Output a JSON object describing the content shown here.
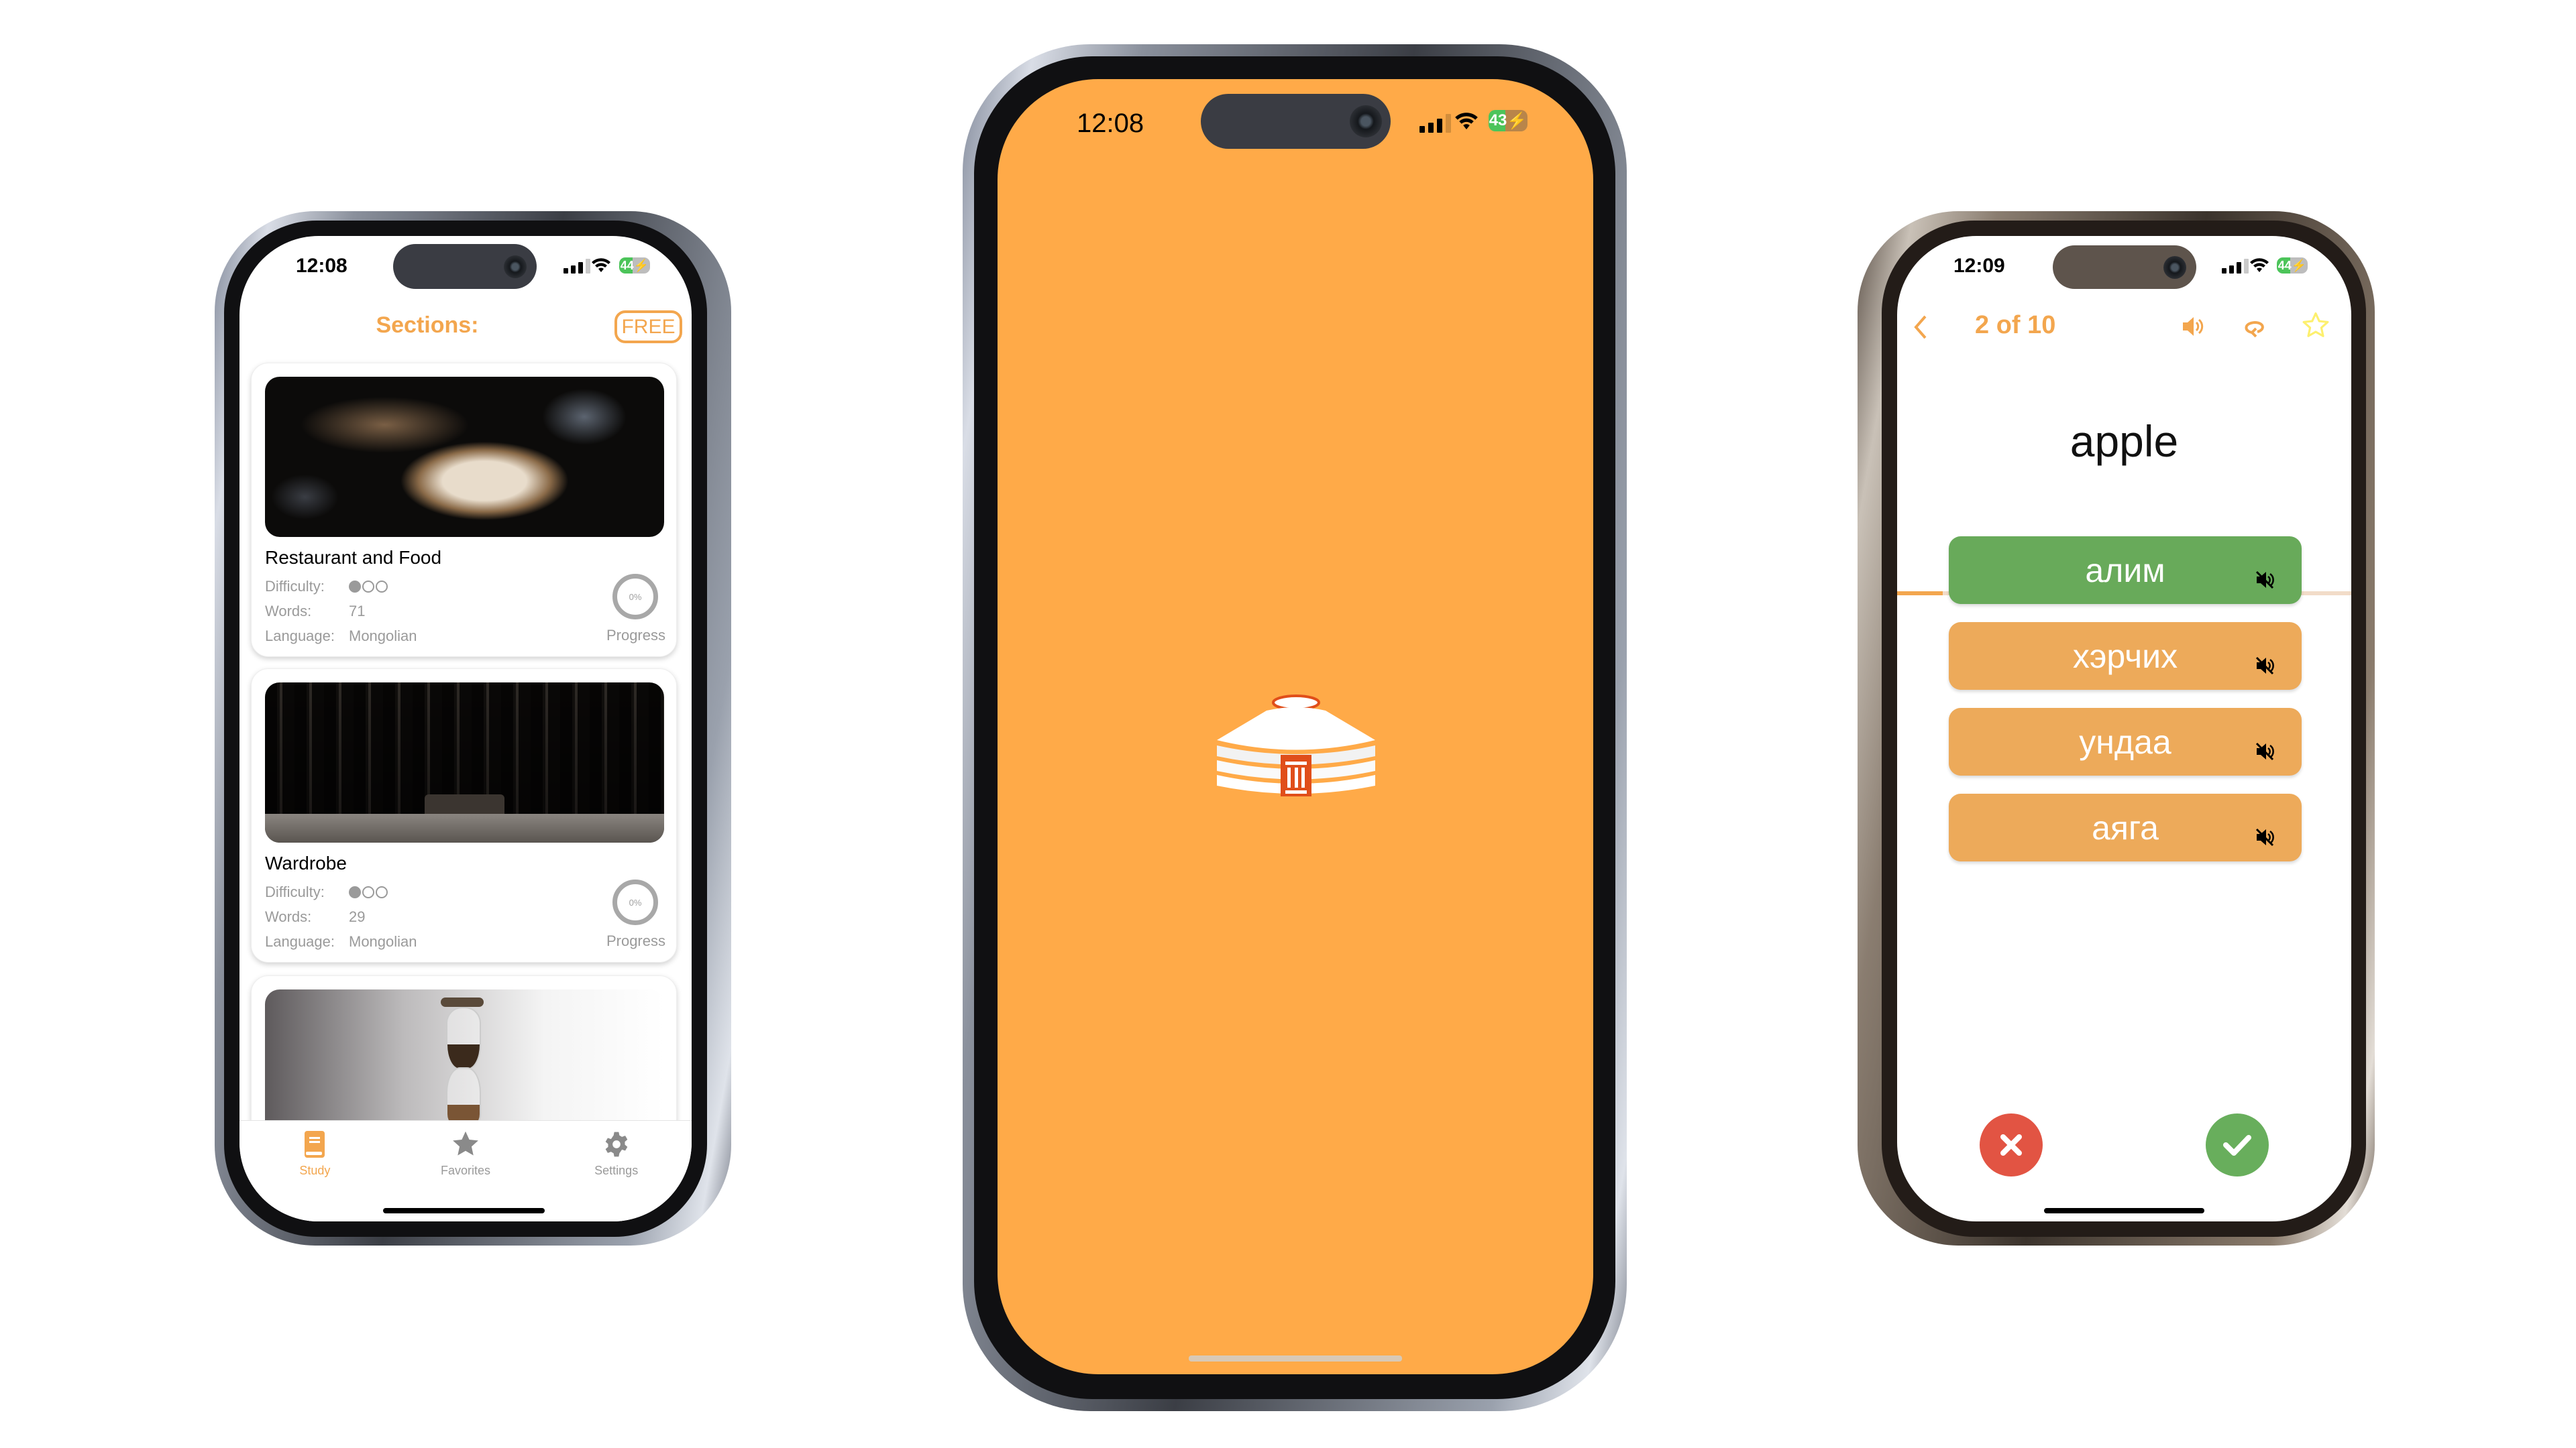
{
  "phones": {
    "sections": {
      "status": {
        "time": "12:08",
        "battery": "44"
      },
      "title": "Sections:",
      "badge": "FREE",
      "cards": [
        {
          "title": "Restaurant and Food",
          "image": "dumplings-photo",
          "difficulty_label": "Difficulty:",
          "difficulty_level": 1,
          "difficulty_max": 3,
          "words_label": "Words:",
          "words": "71",
          "language_label": "Language:",
          "language": "Mongolian",
          "progress": "0%",
          "progress_label": "Progress"
        },
        {
          "title": "Wardrobe",
          "image": "wardrobe-photo",
          "difficulty_label": "Difficulty:",
          "difficulty_level": 1,
          "difficulty_max": 3,
          "words_label": "Words:",
          "words": "29",
          "language_label": "Language:",
          "language": "Mongolian",
          "progress": "0%",
          "progress_label": "Progress"
        },
        {
          "image": "hourglass-photo"
        }
      ],
      "tabs": [
        {
          "label": "Study",
          "icon": "book-icon",
          "active": true
        },
        {
          "label": "Favorites",
          "icon": "star-icon",
          "active": false
        },
        {
          "label": "Settings",
          "icon": "gear-icon",
          "active": false
        }
      ]
    },
    "splash": {
      "status": {
        "time": "12:08",
        "battery": "43"
      },
      "logo": "yurt-icon"
    },
    "quiz": {
      "status": {
        "time": "12:09",
        "battery": "44"
      },
      "counter": "2 of 10",
      "progress_fraction": 0.1,
      "word": "apple",
      "options": [
        {
          "text": "алим",
          "state": "correct"
        },
        {
          "text": "хэрчих",
          "state": "neutral"
        },
        {
          "text": "ундаа",
          "state": "neutral"
        },
        {
          "text": "аяга",
          "state": "neutral"
        }
      ]
    }
  },
  "colors": {
    "accent": "#F3A64E",
    "splash_background": "#FFAA48",
    "option_neutral": "#EDAA5A",
    "option_correct": "#68AA5A",
    "wrong_button": "#E25443",
    "right_button": "#68AE5C",
    "battery_green": "#4CC45A",
    "yurt_red": "#E04E1A"
  }
}
